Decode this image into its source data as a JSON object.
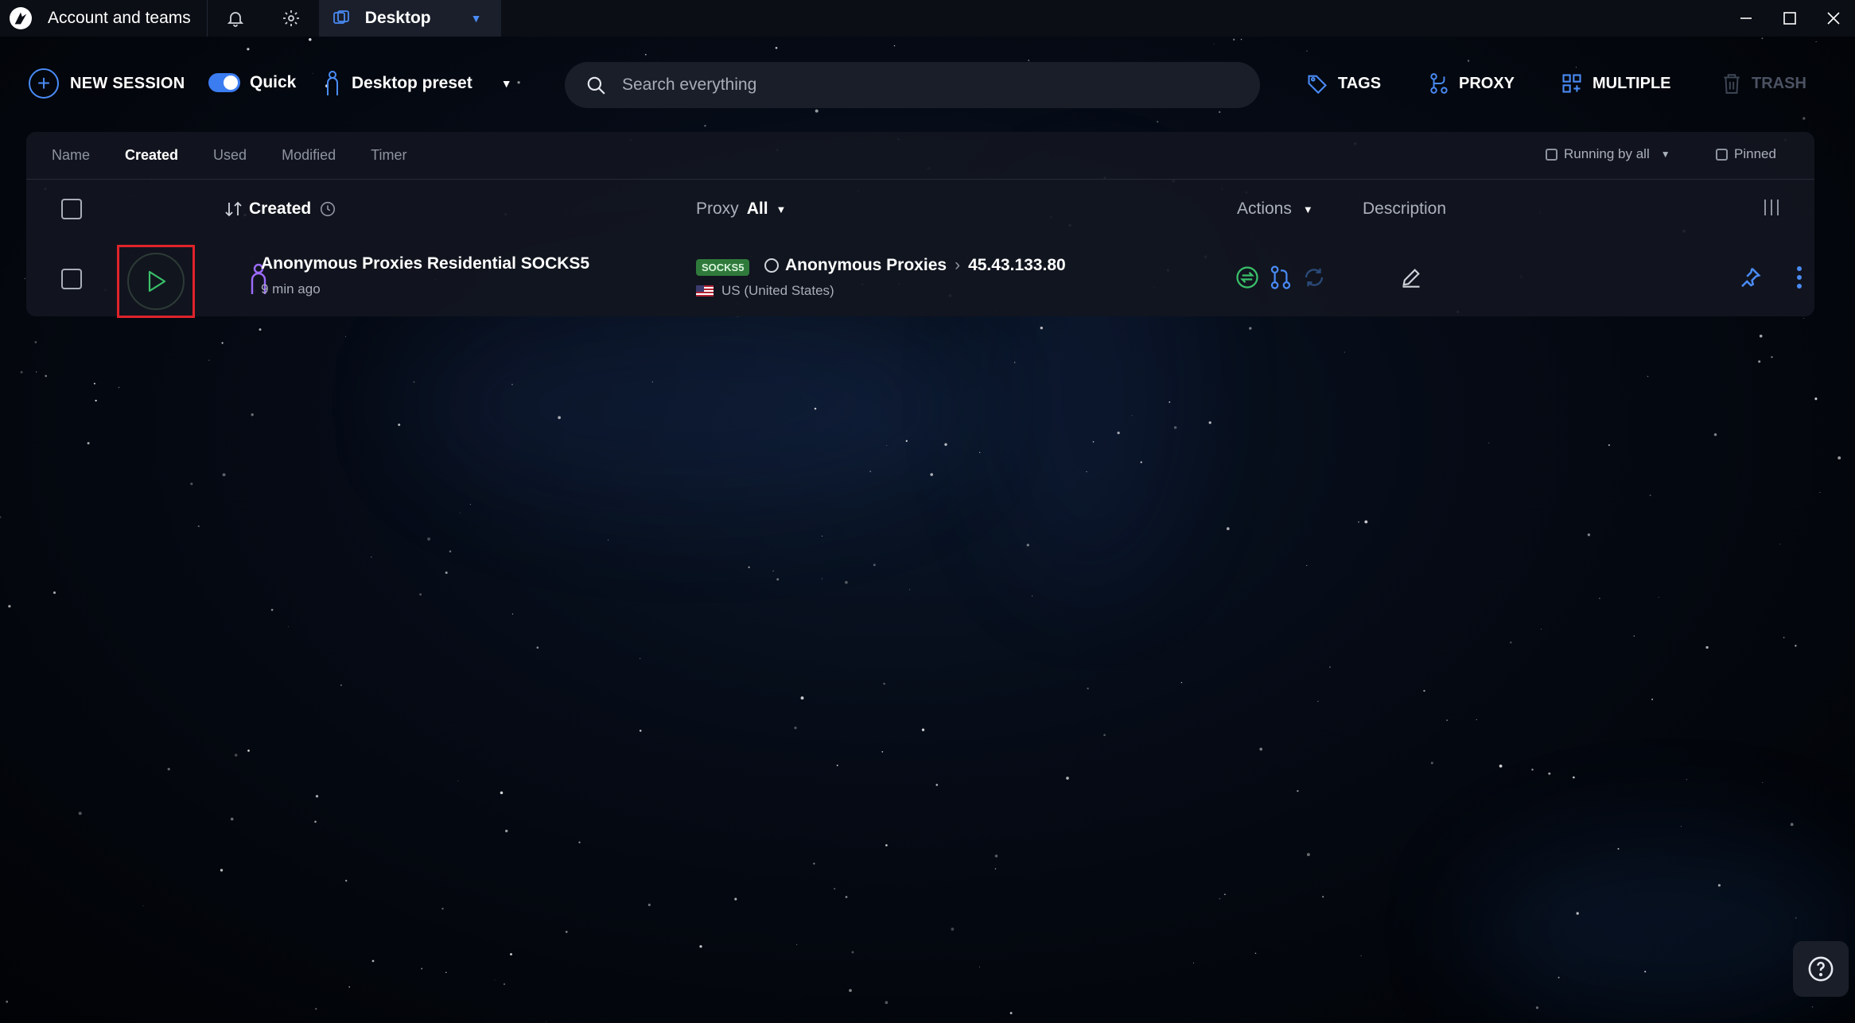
{
  "titlebar": {
    "title": "Account and teams",
    "tab_label": "Desktop"
  },
  "toolbar": {
    "new_session_label": "NEW SESSION",
    "quick_label": "Quick",
    "preset_label": "Desktop preset",
    "search_placeholder": "Search everything",
    "tags_label": "TAGS",
    "proxy_label": "PROXY",
    "multiple_label": "MULTIPLE",
    "trash_label": "TRASH"
  },
  "filters": {
    "tabs": [
      "Name",
      "Created",
      "Used",
      "Modified",
      "Timer"
    ],
    "active_tab": "Created",
    "running_by_all_label": "Running by all",
    "pinned_label": "Pinned"
  },
  "table_header": {
    "created_label": "Created",
    "proxy_label": "Proxy",
    "proxy_filter": "All",
    "actions_label": "Actions",
    "description_label": "Description"
  },
  "sessions": [
    {
      "name": "Anonymous Proxies Residential SOCKS5",
      "created_ago": "9 min ago",
      "proxy_type": "SOCKS5",
      "proxy_provider": "Anonymous Proxies",
      "proxy_ip": "45.43.133.80",
      "country": "US (United States)"
    }
  ],
  "colors": {
    "accent": "#3b7cf0",
    "play_highlight": "#e0232b",
    "socks_badge": "#2f7a3b",
    "profile_icon": "#9d6bff"
  }
}
